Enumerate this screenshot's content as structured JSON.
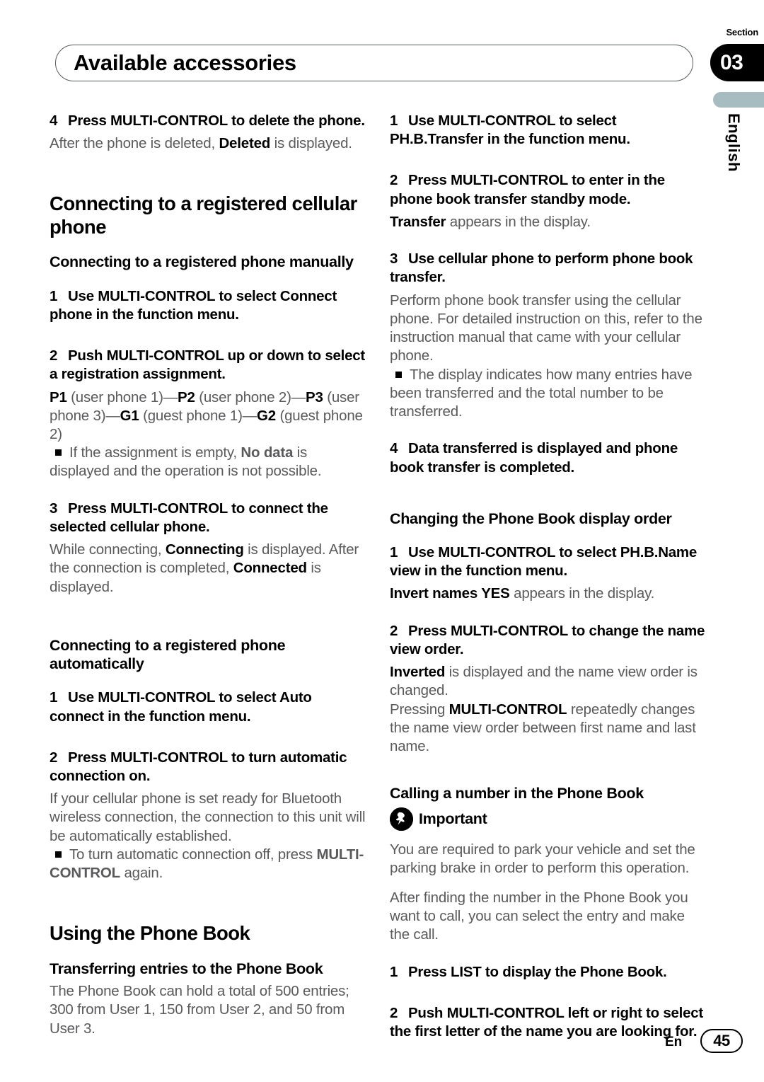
{
  "header": {
    "title": "Available accessories",
    "section_label": "Section",
    "section_number": "03",
    "language": "English"
  },
  "footer": {
    "language_code": "En",
    "page_number": "45"
  },
  "left_column": {
    "step4": {
      "num": "4",
      "text": "Press MULTI-CONTROL to delete the phone.",
      "body_pre": "After the phone is deleted, ",
      "body_kw": "Deleted",
      "body_post": " is displayed."
    },
    "heading_connecting": "Connecting to a registered cellular phone",
    "sub_manually": "Connecting to a registered phone manually",
    "step1_manual": {
      "num": "1",
      "text": "Use MULTI-CONTROL to select Connect phone in the function menu."
    },
    "step2_manual": {
      "num": "2",
      "text": "Push MULTI-CONTROL up or down to select a registration assignment.",
      "assignments": "P1 (user phone 1)—P2 (user phone 2)—P3 (user phone 3)—G1 (guest phone 1)—G2 (guest phone 2)",
      "bullet_pre": "If the assignment is empty, ",
      "bullet_kw": "No data",
      "bullet_post": " is displayed and the operation is not possible."
    },
    "step3_manual": {
      "num": "3",
      "text": "Press MULTI-CONTROL to connect the selected cellular phone.",
      "body_pre": "While connecting, ",
      "body_kw1": "Connecting",
      "body_mid": " is displayed. After the connection is completed, ",
      "body_kw2": "Connected",
      "body_post": " is displayed."
    },
    "sub_automatically": "Connecting to a registered phone automatically",
    "step1_auto": {
      "num": "1",
      "text": "Use MULTI-CONTROL to select Auto connect in the function menu."
    },
    "step2_auto": {
      "num": "2",
      "text": "Press MULTI-CONTROL to turn automatic connection on.",
      "body": "If your cellular phone is set ready for Bluetooth wireless connection, the connection to this unit will be automatically established.",
      "bullet_pre": "To turn automatic connection off, press ",
      "bullet_kw": "MULTI-CONTROL",
      "bullet_post": " again."
    },
    "heading_phonebook": "Using the Phone Book",
    "sub_transferring": "Transferring entries to the Phone Book",
    "transferring_body": "The Phone Book can hold a total of 500 entries; 300 from User 1, 150 from User 2, and 50 from User 3."
  },
  "right_column": {
    "step1_transfer": {
      "num": "1",
      "text": "Use MULTI-CONTROL to select PH.B.Transfer in the function menu."
    },
    "step2_transfer": {
      "num": "2",
      "text": "Press MULTI-CONTROL to enter in the phone book transfer standby mode.",
      "body_kw": "Transfer",
      "body_post": " appears in the display."
    },
    "step3_transfer": {
      "num": "3",
      "text": "Use cellular phone to perform phone book transfer.",
      "body": "Perform phone book transfer using the cellular phone. For detailed instruction on this, refer to the instruction manual that came with your cellular phone.",
      "bullet": "The display indicates how many entries have been transferred and the total number to be transferred."
    },
    "step4_transfer": {
      "num": "4",
      "text": "Data transferred is displayed and phone book transfer is completed."
    },
    "sub_display_order": "Changing the Phone Book display order",
    "step1_order": {
      "num": "1",
      "text": "Use MULTI-CONTROL to select PH.B.Name view in the function menu.",
      "body_kw": "Invert names YES",
      "body_post": " appears in the display."
    },
    "step2_order": {
      "num": "2",
      "text": "Press MULTI-CONTROL to change the name view order.",
      "body1_kw": "Inverted",
      "body1_post": " is displayed and the name view order is changed.",
      "body2_pre": "Pressing ",
      "body2_kw": "MULTI-CONTROL",
      "body2_post": " repeatedly changes the name view order between first name and last name."
    },
    "sub_calling": "Calling a number in the Phone Book",
    "important_label": "Important",
    "important_body": "You are required to park your vehicle and set the parking brake in order to perform this operation.",
    "calling_body": "After finding the number in the Phone Book you want to call, you can select the entry and make the call.",
    "step1_call": {
      "num": "1",
      "text": "Press LIST to display the Phone Book."
    },
    "step2_call": {
      "num": "2",
      "text": "Push MULTI-CONTROL left or right to select the first letter of the name you are looking for."
    }
  }
}
